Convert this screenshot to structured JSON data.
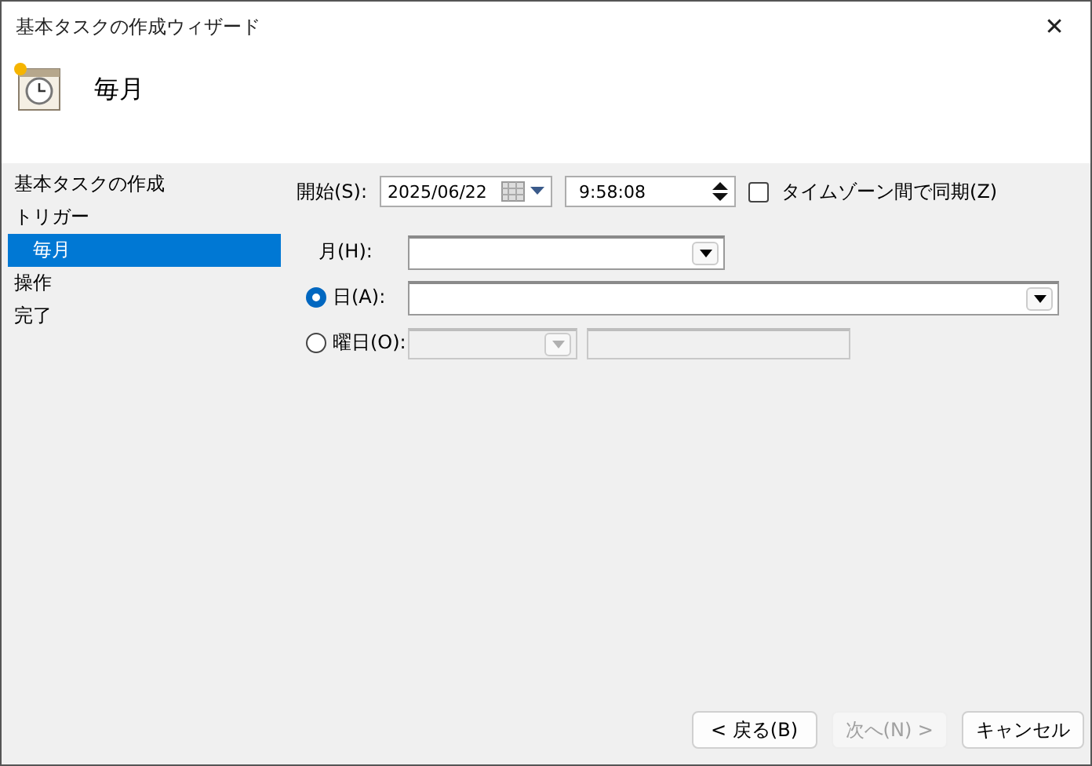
{
  "window": {
    "title": "基本タスクの作成ウィザード",
    "close": "✕"
  },
  "header": {
    "title": "毎月"
  },
  "steps": [
    {
      "label": "基本タスクの作成",
      "selected": false
    },
    {
      "label": "トリガー",
      "selected": false,
      "children": [
        {
          "label": "毎月",
          "selected": true
        }
      ]
    },
    {
      "label": "操作",
      "selected": false
    },
    {
      "label": "完了",
      "selected": false
    }
  ],
  "start": {
    "label": "開始(S):",
    "date": "2025/06/22",
    "time": "9:58:08",
    "sync": {
      "label": "タイムゾーン間で同期(Z)",
      "checked": false
    }
  },
  "rows": [
    {
      "kind": "label",
      "label": "月(H):",
      "combos": [
        {
          "disabled": false
        }
      ]
    },
    {
      "kind": "radio",
      "label": "日(A):",
      "selected": true,
      "combos": [
        {
          "disabled": false
        }
      ]
    },
    {
      "kind": "radio",
      "label": "曜日(O):",
      "selected": false,
      "combos": [
        {
          "disabled": true
        },
        {
          "disabled": true
        }
      ]
    }
  ],
  "buttons": [
    {
      "label": "< 戻る(B)",
      "disabled": false
    },
    {
      "label": "次へ(N) >",
      "disabled": true
    },
    {
      "label": "キャンセル",
      "disabled": false
    }
  ]
}
